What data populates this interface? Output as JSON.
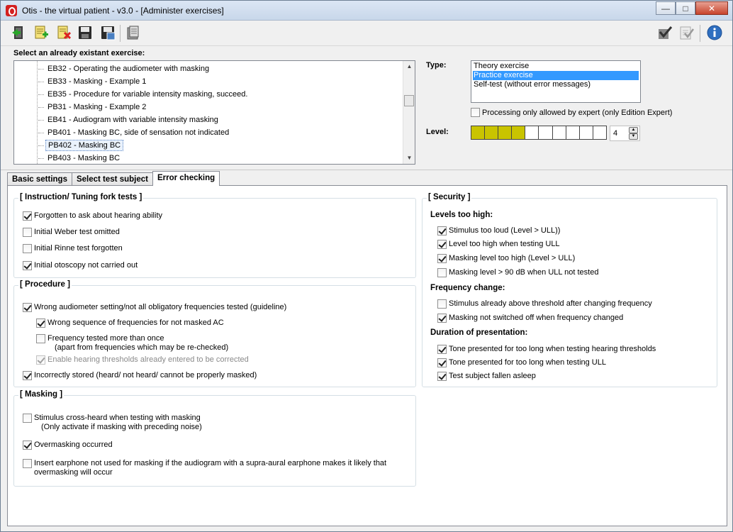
{
  "window": {
    "title": "Otis - the virtual patient - v3.0 - [Administer exercises]",
    "controls": {
      "minimize": "—",
      "maximize": "□",
      "close": "✕"
    }
  },
  "toolbar": {
    "icons": [
      "exit-icon",
      "new-exercise-icon",
      "delete-exercise-icon",
      "save-icon",
      "save-as-icon",
      "print-icon",
      "check-icon",
      "checklist-icon",
      "info-icon"
    ]
  },
  "exercise_list": {
    "label": "Select an already existant exercise:",
    "items": [
      "EB32 - Operating the audiometer with masking",
      "EB33 - Masking - Example 1",
      "EB35 - Procedure for variable intensity masking, succeed.",
      "PB31 - Masking - Example 2",
      "EB41 - Audiogram with variable intensity masking",
      "PB401 - Masking BC, side of sensation not indicated",
      "PB402 - Masking BC",
      "PB403 - Masking BC"
    ],
    "selected": "PB402 - Masking BC"
  },
  "type": {
    "label": "Type:",
    "options": [
      "Theory exercise",
      "Practice exercise",
      "Self-test (without  error messages)"
    ],
    "selected": "Practice exercise"
  },
  "expert_only": {
    "label": "Processing only allowed by expert (only Edition Expert)",
    "checked": false
  },
  "level": {
    "label": "Level:",
    "value": "4",
    "max_cells": 10,
    "bar_color": "#c9c400"
  },
  "tabs": [
    {
      "label": "Basic settings",
      "active": false
    },
    {
      "label": "Select test subject",
      "active": false
    },
    {
      "label": "Error checking",
      "active": true
    }
  ],
  "instruction_group": {
    "title": "[ Instruction/ Tuning fork tests ]",
    "items": [
      {
        "label": "Forgotten to ask about hearing ability",
        "checked": true
      },
      {
        "label": "Initial Weber test omitted",
        "checked": false
      },
      {
        "label": "Initial Rinne test forgotten",
        "checked": false
      },
      {
        "label": "Initial otoscopy not carried out",
        "checked": true
      }
    ]
  },
  "procedure_group": {
    "title": "[ Procedure ]",
    "items": [
      {
        "label": "Wrong audiometer setting/not all obligatory frequencies tested (guideline)",
        "checked": true
      },
      {
        "label": "Wrong sequence of frequencies for not masked AC",
        "checked": true
      },
      {
        "label": "Frequency tested more than once",
        "label2": "(apart from frequencies which may be re-checked)",
        "checked": false
      },
      {
        "label": "Enable hearing thresholds already entered to be corrected",
        "checked": true,
        "disabled": true
      },
      {
        "label": "Incorrectly stored (heard/ not heard/ cannot be properly masked)",
        "checked": true
      }
    ]
  },
  "masking_group": {
    "title": "[ Masking ]",
    "items": [
      {
        "label": "Stimulus cross-heard when testing with masking",
        "label2": "(Only activate if masking with preceding noise)",
        "checked": false
      },
      {
        "label": "Overmasking occurred",
        "checked": true
      },
      {
        "label": "Insert earphone not used for masking if the audiogram with a supra-aural earphone makes it likely that",
        "label2": "overmasking will occur",
        "checked": false
      }
    ]
  },
  "security_group": {
    "title": "[ Security ]",
    "levels_heading": "Levels too high:",
    "levels": [
      {
        "label": "Stimulus too loud (Level > ULL))",
        "checked": true
      },
      {
        "label": "Level too high when testing ULL",
        "checked": true
      },
      {
        "label": "Masking level too high (Level > ULL)",
        "checked": true
      },
      {
        "label": "Masking level > 90 dB when ULL not tested",
        "checked": false
      }
    ],
    "freq_heading": "Frequency change:",
    "freq": [
      {
        "label": "Stimulus already above threshold after changing frequency",
        "checked": false
      },
      {
        "label": "Masking not switched off when frequency changed",
        "checked": true
      }
    ],
    "duration_heading": "Duration of presentation:",
    "duration": [
      {
        "label": "Tone presented for too long when testing hearing thresholds",
        "checked": true
      },
      {
        "label": "Tone presented for too long when testing ULL",
        "checked": true
      },
      {
        "label": "Test subject fallen asleep",
        "checked": true
      }
    ]
  }
}
